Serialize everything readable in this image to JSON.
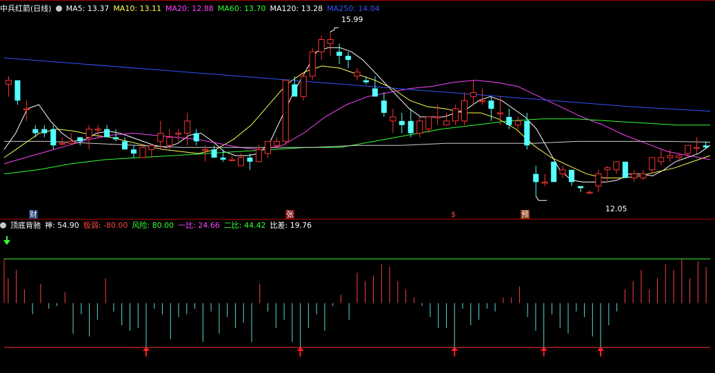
{
  "header": {
    "title": "中兵红箭(日线)",
    "ma": [
      {
        "label": "MA5: 13.37",
        "color": "#ffffff"
      },
      {
        "label": "MA10: 13.11",
        "color": "#ffff55"
      },
      {
        "label": "MA20: 12.88",
        "color": "#ff44ff"
      },
      {
        "label": "MA60: 13.70",
        "color": "#33ff33"
      },
      {
        "label": "MA120: 13.28",
        "color": "#ffffff"
      },
      {
        "label": "MA250: 14.04",
        "color": "#3355ff"
      }
    ]
  },
  "markers": [
    {
      "label": "财",
      "bg": "#1a3a6e",
      "color": "#ffffff"
    },
    {
      "label": "张",
      "bg": "#7a1010",
      "color": "#ffffff"
    },
    {
      "label": "$",
      "bg": "#000000",
      "color": "#ff4444"
    },
    {
      "label": "预",
      "bg": "#8a3a10",
      "color": "#ffffff"
    }
  ],
  "annotations": {
    "high": "15.99",
    "low": "12.05"
  },
  "indicator": {
    "name": "顶底背驰",
    "values": [
      {
        "label": "神: 54.90",
        "color": "#ffffff"
      },
      {
        "label": "极弱: -80.00",
        "color": "#ff4444"
      },
      {
        "label": "风险: 80.00",
        "color": "#33ff33"
      },
      {
        "label": "一比: 24.66",
        "color": "#ff44ff"
      },
      {
        "label": "二比: 44.42",
        "color": "#33ff33"
      },
      {
        "label": "比差: 19.76",
        "color": "#ffffff"
      }
    ]
  },
  "chart_data": {
    "type": "candlestick",
    "ylim": [
      11.7,
      16.4
    ],
    "candles": [
      [
        14.7,
        14.9,
        14.4,
        14.8
      ],
      [
        14.8,
        14.8,
        14.2,
        14.3
      ],
      [
        14.1,
        14.3,
        13.8,
        14.1
      ],
      [
        13.6,
        13.7,
        13.4,
        13.5
      ],
      [
        13.6,
        13.7,
        13.4,
        13.5
      ],
      [
        13.6,
        13.7,
        13.1,
        13.2
      ],
      [
        13.25,
        13.4,
        13.2,
        13.25
      ],
      [
        13.25,
        13.5,
        13.2,
        13.3
      ],
      [
        13.4,
        13.4,
        13.2,
        13.3
      ],
      [
        13.4,
        13.7,
        13.1,
        13.6
      ],
      [
        13.6,
        13.7,
        13.4,
        13.6
      ],
      [
        13.6,
        13.7,
        13.4,
        13.4
      ],
      [
        13.4,
        13.6,
        13.3,
        13.35
      ],
      [
        13.3,
        13.4,
        13.1,
        13.1
      ],
      [
        13.1,
        13.2,
        12.9,
        13.0
      ],
      [
        12.9,
        13.2,
        12.9,
        13.15
      ],
      [
        13.1,
        13.2,
        12.9,
        13.2
      ],
      [
        13.3,
        13.8,
        13.1,
        13.5
      ],
      [
        13.2,
        13.6,
        13.1,
        13.4
      ],
      [
        13.5,
        13.6,
        13.3,
        13.5
      ],
      [
        13.5,
        14.0,
        13.2,
        13.8
      ],
      [
        13.5,
        13.6,
        13.2,
        13.3
      ],
      [
        13.1,
        13.2,
        12.8,
        13.1
      ],
      [
        13.1,
        13.2,
        12.9,
        12.9
      ],
      [
        12.9,
        13.1,
        12.8,
        12.85
      ],
      [
        12.85,
        12.95,
        12.8,
        12.85
      ],
      [
        12.7,
        13.0,
        12.7,
        12.9
      ],
      [
        12.9,
        13.0,
        12.6,
        12.8
      ],
      [
        12.8,
        13.2,
        12.8,
        13.1
      ],
      [
        13.0,
        13.3,
        12.9,
        13.3
      ],
      [
        13.2,
        13.4,
        13.1,
        13.3
      ],
      [
        13.3,
        14.8,
        13.2,
        14.8
      ],
      [
        14.7,
        14.9,
        14.4,
        14.4
      ],
      [
        14.4,
        15.0,
        14.3,
        14.9
      ],
      [
        14.9,
        15.6,
        14.8,
        15.5
      ],
      [
        15.5,
        15.9,
        15.3,
        15.8
      ],
      [
        15.7,
        15.99,
        15.4,
        15.8
      ],
      [
        15.5,
        15.7,
        15.2,
        15.4
      ],
      [
        15.4,
        15.5,
        15.1,
        15.3
      ],
      [
        14.9,
        15.1,
        14.8,
        15.0
      ],
      [
        14.8,
        14.9,
        14.7,
        14.75
      ],
      [
        14.6,
        14.9,
        14.4,
        14.4
      ],
      [
        14.3,
        14.5,
        13.9,
        14.0
      ],
      [
        13.8,
        14.1,
        13.5,
        13.9
      ],
      [
        13.8,
        14.0,
        13.5,
        13.7
      ],
      [
        13.8,
        14.1,
        13.4,
        13.5
      ],
      [
        13.5,
        13.9,
        13.4,
        13.8
      ],
      [
        13.6,
        13.9,
        13.5,
        13.9
      ],
      [
        13.9,
        14.2,
        13.7,
        13.9
      ],
      [
        13.7,
        14.0,
        13.7,
        13.8
      ],
      [
        13.8,
        14.2,
        13.7,
        14.1
      ],
      [
        13.8,
        14.5,
        13.7,
        14.3
      ],
      [
        14.4,
        14.8,
        14.2,
        14.5
      ],
      [
        14.3,
        14.6,
        14.2,
        14.3
      ],
      [
        14.3,
        14.4,
        13.8,
        14.1
      ],
      [
        14.0,
        14.4,
        13.7,
        14.0
      ],
      [
        13.9,
        14.1,
        13.6,
        13.7
      ],
      [
        13.7,
        13.9,
        13.6,
        13.8
      ],
      [
        13.8,
        14.0,
        13.1,
        13.2
      ],
      [
        12.5,
        12.7,
        11.95,
        12.3
      ],
      [
        12.3,
        12.5,
        12.2,
        12.3
      ],
      [
        12.8,
        12.8,
        12.3,
        12.3
      ],
      [
        12.5,
        12.7,
        12.4,
        12.6
      ],
      [
        12.6,
        12.6,
        12.2,
        12.3
      ],
      [
        12.2,
        12.2,
        12.05,
        12.15
      ],
      [
        12.05,
        12.1,
        12.0,
        12.05
      ],
      [
        12.2,
        12.6,
        12.05,
        12.5
      ],
      [
        12.6,
        12.7,
        12.3,
        12.65
      ],
      [
        12.6,
        12.8,
        12.5,
        12.8
      ],
      [
        12.8,
        12.8,
        12.4,
        12.4
      ],
      [
        12.4,
        12.6,
        12.3,
        12.5
      ],
      [
        12.4,
        12.6,
        12.35,
        12.5
      ],
      [
        12.6,
        12.9,
        12.5,
        12.9
      ],
      [
        12.8,
        13.1,
        12.7,
        12.9
      ],
      [
        12.9,
        13.1,
        12.8,
        12.95
      ],
      [
        12.9,
        13.0,
        12.8,
        12.95
      ],
      [
        13.0,
        13.2,
        12.9,
        13.2
      ],
      [
        13.15,
        13.4,
        13.0,
        13.15
      ],
      [
        13.2,
        13.3,
        13.1,
        13.15
      ]
    ],
    "ma": {
      "MA5": [
        13.1,
        13.5,
        14.1,
        14.2,
        13.8,
        13.5,
        13.3,
        13.35,
        13.5,
        13.55,
        13.5,
        13.4,
        13.3,
        13.2,
        13.15,
        13.25,
        13.45,
        13.5,
        13.3,
        13.05,
        12.95,
        12.95,
        13.0,
        13.3,
        13.9,
        14.5,
        15.0,
        15.5,
        15.6,
        15.6,
        15.5,
        15.3,
        15.0,
        14.7,
        14.4,
        14.1,
        13.9,
        13.9,
        13.9,
        14.0,
        14.1,
        14.3,
        14.4,
        14.3,
        14.1,
        13.9,
        13.6,
        13.1,
        12.6,
        12.35,
        12.3,
        12.3,
        12.3,
        12.35,
        12.5,
        12.5,
        12.45,
        12.6,
        12.8,
        12.9,
        13.0,
        13.2
      ],
      "MA10": [
        12.9,
        13.2,
        13.5,
        13.6,
        13.55,
        13.45,
        13.4,
        13.3,
        13.2,
        13.1,
        13.05,
        13.0,
        13.1,
        13.35,
        13.7,
        14.2,
        14.7,
        15.0,
        15.15,
        15.1,
        14.95,
        14.8,
        14.6,
        14.3,
        14.15,
        14.1,
        14.0,
        14.0,
        13.85,
        13.6,
        13.2,
        12.9,
        12.7,
        12.5,
        12.4,
        12.4,
        12.45,
        12.55,
        12.65,
        12.8,
        12.95
      ],
      "MA20": [
        12.75,
        12.9,
        13.05,
        13.2,
        13.35,
        13.45,
        13.5,
        13.45,
        13.4,
        13.35,
        13.25,
        13.15,
        13.1,
        13.2,
        13.5,
        13.9,
        14.2,
        14.4,
        14.5,
        14.6,
        14.65,
        14.75,
        14.8,
        14.75,
        14.65,
        14.4,
        14.15,
        13.9,
        13.7,
        13.45,
        13.25,
        13.05,
        12.95,
        12.85
      ],
      "MA60": [
        12.5,
        12.6,
        12.75,
        12.85,
        12.9,
        12.95,
        13.0,
        13.05,
        13.1,
        13.15,
        13.15,
        13.3,
        13.45,
        13.6,
        13.7,
        13.8,
        13.85,
        13.85,
        13.8,
        13.75,
        13.7,
        13.7
      ],
      "MA120": [
        13.3,
        13.3,
        13.25,
        13.2,
        13.15,
        13.15,
        13.15,
        13.15,
        13.2,
        13.2,
        13.25,
        13.25,
        13.25,
        13.3,
        13.3,
        13.3,
        13.28
      ],
      "MA250": [
        15.35,
        15.2,
        15.05,
        14.9,
        14.75,
        14.6,
        14.45,
        14.3,
        14.15,
        14.04
      ]
    },
    "indicator": {
      "ylim": [
        -100,
        100
      ],
      "risk_line": 80,
      "weak_line": -80,
      "bars": [
        45,
        60,
        25,
        -20,
        35,
        -10,
        -5,
        20,
        -55,
        -20,
        -60,
        -30,
        45,
        -15,
        -40,
        -50,
        -45,
        -80,
        -10,
        -20,
        -65,
        -25,
        -20,
        -10,
        -70,
        -15,
        -55,
        -25,
        -45,
        -35,
        -70,
        35,
        -15,
        -45,
        -30,
        -70,
        -80,
        -45,
        -20,
        -50,
        -5,
        15,
        -30,
        55,
        40,
        50,
        70,
        65,
        40,
        25,
        10,
        -5,
        -25,
        -45,
        -45,
        -80,
        -10,
        -40,
        -30,
        -10,
        -15,
        10,
        10,
        30,
        -25,
        -50,
        -80,
        -20,
        -45,
        -55,
        -15,
        -25,
        -60,
        -80,
        -40,
        -15,
        25,
        40,
        60,
        25,
        45,
        70,
        60,
        80,
        45,
        75,
        65
      ]
    }
  }
}
